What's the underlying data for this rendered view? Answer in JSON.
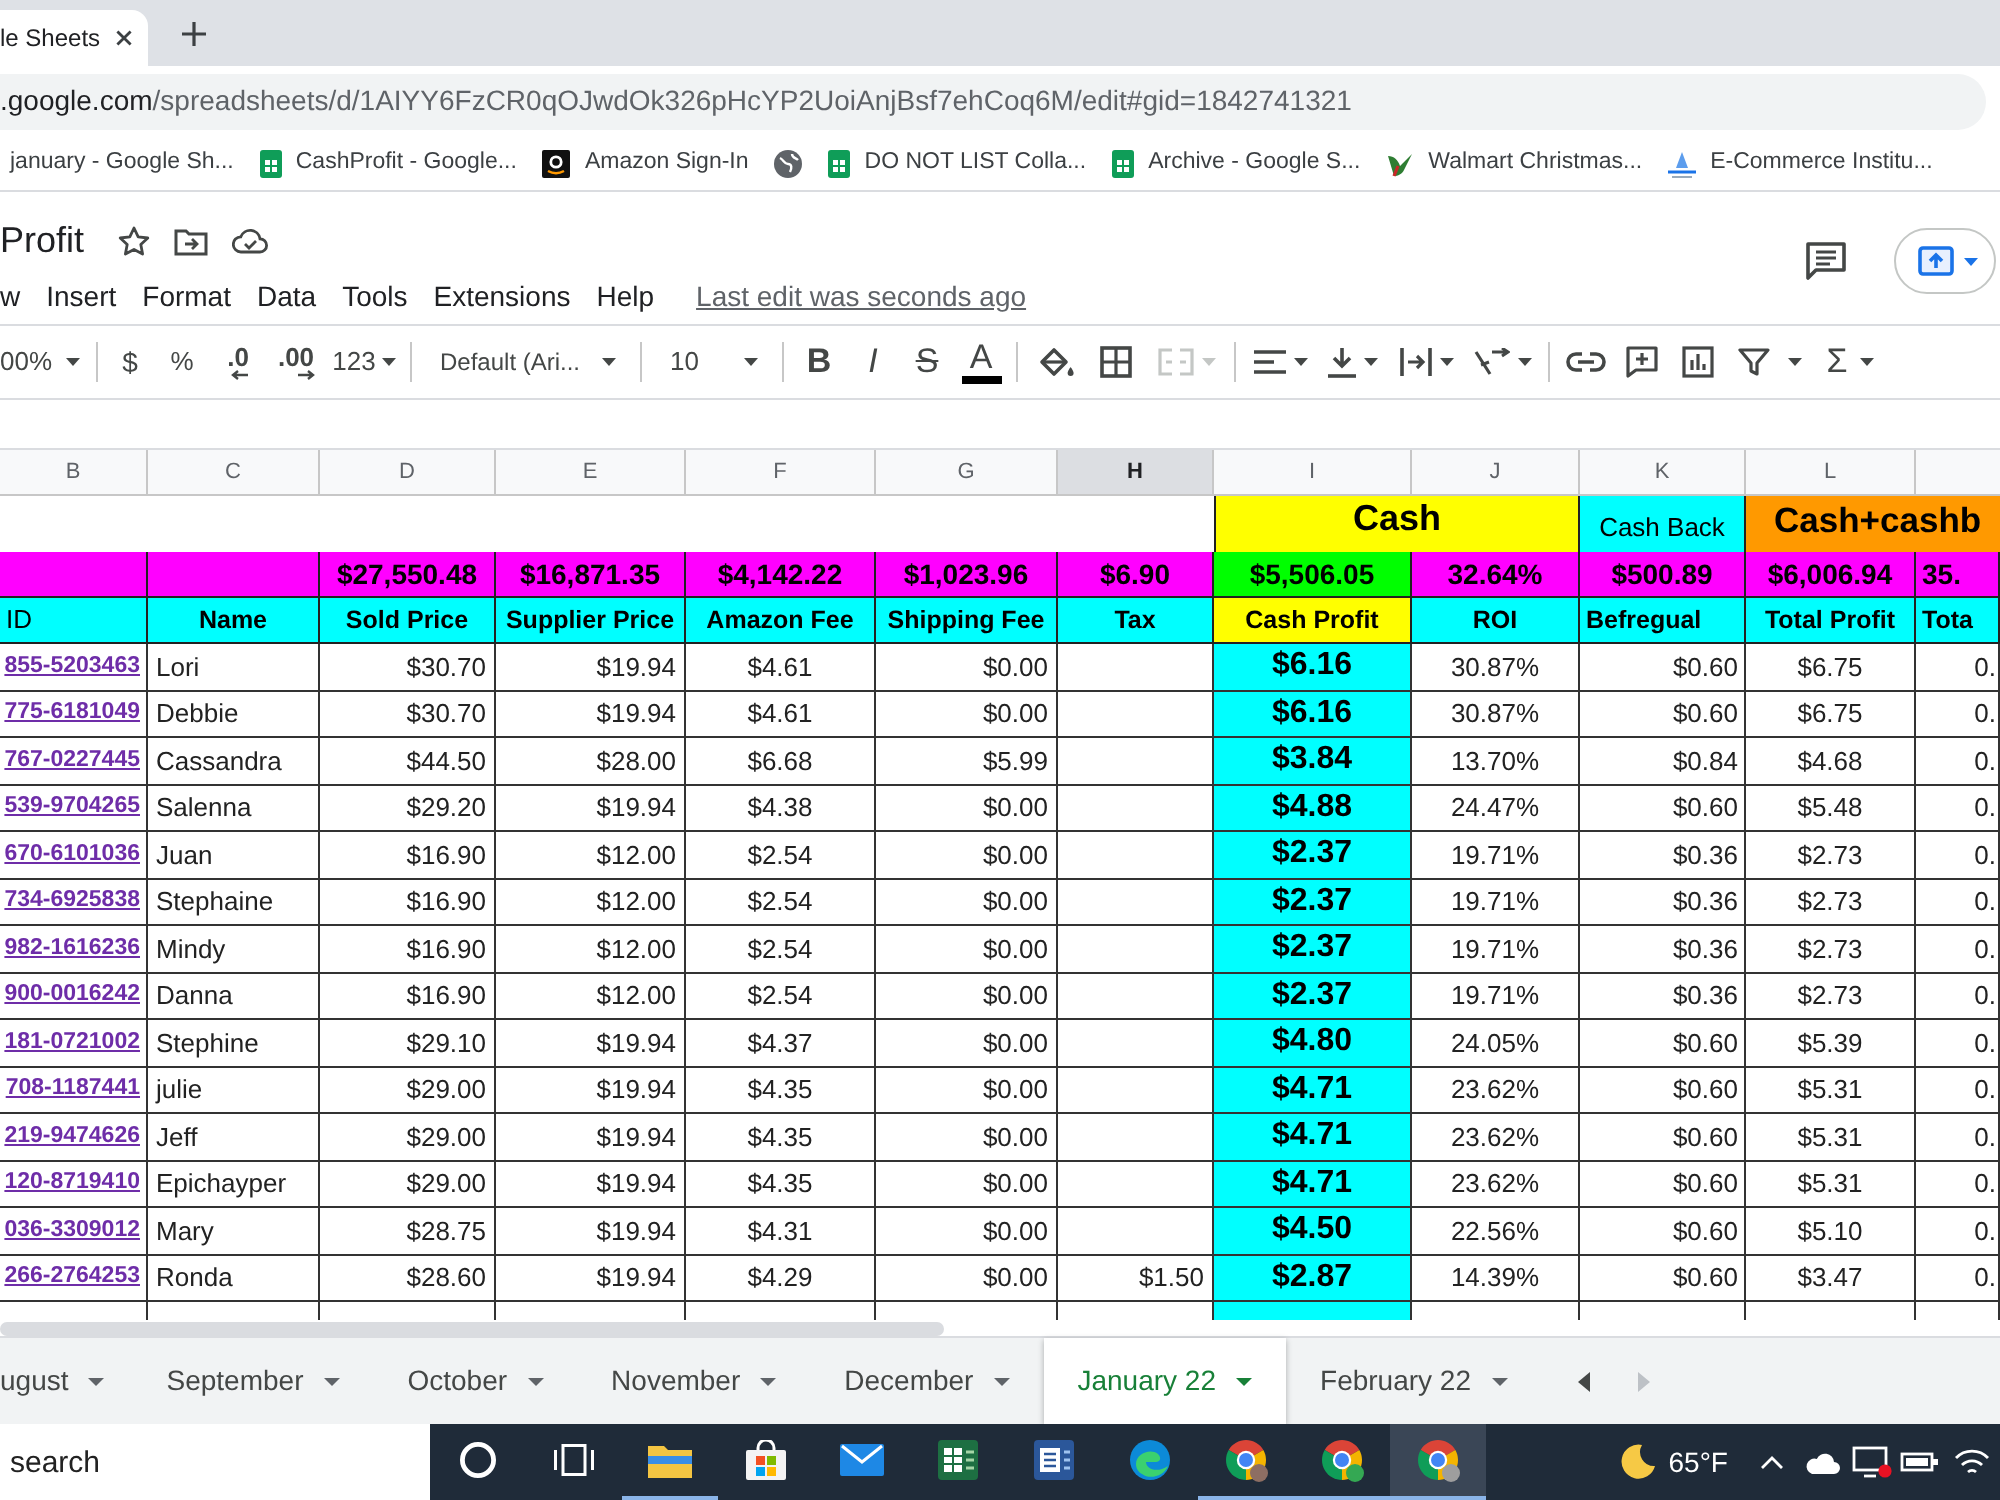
{
  "browser": {
    "tab_title": "le Sheets",
    "url": {
      "host": ".google.com",
      "path": "/spreadsheets/d/1AIYY6FzCR0qOJwdOk326pHcYP2UoiAnjBsf7ehCoq6M/edit#gid=1842741321"
    },
    "bookmarks": [
      {
        "kind": "plain",
        "label": "january - Google Sh..."
      },
      {
        "kind": "sheet",
        "label": "CashProfit - Google..."
      },
      {
        "kind": "shop",
        "label": "Amazon Sign-In"
      },
      {
        "kind": "globe"
      },
      {
        "kind": "sheet",
        "label": "DO NOT LIST Colla..."
      },
      {
        "kind": "sheet",
        "label": "Archive - Google S..."
      },
      {
        "kind": "bird",
        "label": "Walmart Christmas..."
      },
      {
        "kind": "site",
        "label": "E-Commerce Institu..."
      }
    ]
  },
  "document": {
    "title": "Profit",
    "menu": [
      "w",
      "Insert",
      "Format",
      "Data",
      "Tools",
      "Extensions",
      "Help"
    ],
    "last_edit": "Last edit was seconds ago"
  },
  "toolbar": {
    "zoom": "00%",
    "currency": "$",
    "percent": "%",
    "decrease_decimals": ".0",
    "increase_decimals": ".00",
    "more_formats": "123",
    "font": "Default (Ari...",
    "font_size": "10",
    "bold": "B",
    "italic": "I",
    "strikethrough": "S",
    "text_color": "A",
    "functions": "Σ"
  },
  "sheet": {
    "column_letters": [
      {
        "letter": "B",
        "selected": false
      },
      {
        "letter": "C",
        "selected": false
      },
      {
        "letter": "D",
        "selected": false
      },
      {
        "letter": "E",
        "selected": false
      },
      {
        "letter": "F",
        "selected": false
      },
      {
        "letter": "G",
        "selected": false
      },
      {
        "letter": "H",
        "selected": true
      },
      {
        "letter": "I",
        "selected": false
      },
      {
        "letter": "J",
        "selected": false
      },
      {
        "letter": "K",
        "selected": false
      },
      {
        "letter": "L",
        "selected": false
      }
    ],
    "groups": {
      "cash": "Cash",
      "cash_back": "Cash Back",
      "cash_plus_cashback": "Cash+cashb"
    },
    "totals": {
      "sold_price": "$27,550.48",
      "supplier_price": "$16,871.35",
      "amazon_fee": "$4,142.22",
      "shipping_fee": "$1,023.96",
      "tax": "$6.90",
      "cash_profit": "$5,506.05",
      "roi": "32.64%",
      "befregual": "$500.89",
      "total_profit": "$6,006.94",
      "column_12": "35."
    },
    "headers": {
      "id": "ID",
      "name": "Name",
      "sold_price": "Sold Price",
      "supplier_price": "Supplier Price",
      "amazon_fee": "Amazon Fee",
      "shipping_fee": "Shipping Fee",
      "tax": "Tax",
      "cash_profit": "Cash Profit",
      "roi": "ROI",
      "befregual": "Befregual",
      "total_profit": "Total Profit",
      "column_12": "Tota"
    },
    "rows": [
      {
        "id": "855-5203463",
        "name": "Lori",
        "sold_price": "$30.70",
        "supplier_price": "$19.94",
        "amazon_fee": "$4.61",
        "shipping_fee": "$0.00",
        "cash_profit": "$6.16",
        "roi": "30.87%",
        "befregual": "$0.60",
        "total_profit": "$6.75",
        "column_12": "0."
      },
      {
        "id": "775-6181049",
        "name": "Debbie",
        "sold_price": "$30.70",
        "supplier_price": "$19.94",
        "amazon_fee": "$4.61",
        "shipping_fee": "$0.00",
        "cash_profit": "$6.16",
        "roi": "30.87%",
        "befregual": "$0.60",
        "total_profit": "$6.75",
        "column_12": "0."
      },
      {
        "id": "767-0227445",
        "name": "Cassandra",
        "sold_price": "$44.50",
        "supplier_price": "$28.00",
        "amazon_fee": "$6.68",
        "shipping_fee": "$5.99",
        "cash_profit": "$3.84",
        "roi": "13.70%",
        "befregual": "$0.84",
        "total_profit": "$4.68",
        "column_12": "0."
      },
      {
        "id": "539-9704265",
        "name": "Salenna",
        "sold_price": "$29.20",
        "supplier_price": "$19.94",
        "amazon_fee": "$4.38",
        "shipping_fee": "$0.00",
        "cash_profit": "$4.88",
        "roi": "24.47%",
        "befregual": "$0.60",
        "total_profit": "$5.48",
        "column_12": "0."
      },
      {
        "id": "670-6101036",
        "name": "Juan",
        "sold_price": "$16.90",
        "supplier_price": "$12.00",
        "amazon_fee": "$2.54",
        "shipping_fee": "$0.00",
        "cash_profit": "$2.37",
        "roi": "19.71%",
        "befregual": "$0.36",
        "total_profit": "$2.73",
        "column_12": "0."
      },
      {
        "id": "734-6925838",
        "name": "Stephaine",
        "sold_price": "$16.90",
        "supplier_price": "$12.00",
        "amazon_fee": "$2.54",
        "shipping_fee": "$0.00",
        "cash_profit": "$2.37",
        "roi": "19.71%",
        "befregual": "$0.36",
        "total_profit": "$2.73",
        "column_12": "0."
      },
      {
        "id": "982-1616236",
        "name": "Mindy",
        "sold_price": "$16.90",
        "supplier_price": "$12.00",
        "amazon_fee": "$2.54",
        "shipping_fee": "$0.00",
        "cash_profit": "$2.37",
        "roi": "19.71%",
        "befregual": "$0.36",
        "total_profit": "$2.73",
        "column_12": "0."
      },
      {
        "id": "900-0016242",
        "name": "Danna",
        "sold_price": "$16.90",
        "supplier_price": "$12.00",
        "amazon_fee": "$2.54",
        "shipping_fee": "$0.00",
        "cash_profit": "$2.37",
        "roi": "19.71%",
        "befregual": "$0.36",
        "total_profit": "$2.73",
        "column_12": "0."
      },
      {
        "id": "181-0721002",
        "name": "Stephine",
        "sold_price": "$29.10",
        "supplier_price": "$19.94",
        "amazon_fee": "$4.37",
        "shipping_fee": "$0.00",
        "cash_profit": "$4.80",
        "roi": "24.05%",
        "befregual": "$0.60",
        "total_profit": "$5.39",
        "column_12": "0."
      },
      {
        "id": "708-1187441",
        "name": "julie",
        "sold_price": "$29.00",
        "supplier_price": "$19.94",
        "amazon_fee": "$4.35",
        "shipping_fee": "$0.00",
        "cash_profit": "$4.71",
        "roi": "23.62%",
        "befregual": "$0.60",
        "total_profit": "$5.31",
        "column_12": "0."
      },
      {
        "id": "219-9474626",
        "name": "Jeff",
        "sold_price": "$29.00",
        "supplier_price": "$19.94",
        "amazon_fee": "$4.35",
        "shipping_fee": "$0.00",
        "cash_profit": "$4.71",
        "roi": "23.62%",
        "befregual": "$0.60",
        "total_profit": "$5.31",
        "column_12": "0."
      },
      {
        "id": "120-8719410",
        "name": "Epichayper",
        "sold_price": "$29.00",
        "supplier_price": "$19.94",
        "amazon_fee": "$4.35",
        "shipping_fee": "$0.00",
        "cash_profit": "$4.71",
        "roi": "23.62%",
        "befregual": "$0.60",
        "total_profit": "$5.31",
        "column_12": "0."
      },
      {
        "id": "036-3309012",
        "name": "Mary",
        "sold_price": "$28.75",
        "supplier_price": "$19.94",
        "amazon_fee": "$4.31",
        "shipping_fee": "$0.00",
        "cash_profit": "$4.50",
        "roi": "22.56%",
        "befregual": "$0.60",
        "total_profit": "$5.10",
        "column_12": "0."
      },
      {
        "id": "266-2764253",
        "name": "Ronda",
        "sold_price": "$28.60",
        "supplier_price": "$19.94",
        "amazon_fee": "$4.29",
        "shipping_fee": "$0.00",
        "tax": "$1.50",
        "cash_profit": "$2.87",
        "roi": "14.39%",
        "befregual": "$0.60",
        "total_profit": "$3.47",
        "column_12": "0."
      }
    ]
  },
  "sheet_tabs": [
    {
      "label": "ugust",
      "selected": false
    },
    {
      "label": "September",
      "selected": false
    },
    {
      "label": "October",
      "selected": false
    },
    {
      "label": "November",
      "selected": false
    },
    {
      "label": "December",
      "selected": false
    },
    {
      "label": "January 22",
      "selected": true
    },
    {
      "label": "February 22",
      "selected": false
    }
  ],
  "taskbar": {
    "search": {
      "placeholder": "search"
    },
    "apps": [
      {
        "running": false,
        "selected": false
      },
      {
        "running": false,
        "selected": false
      },
      {
        "running": true,
        "selected": false
      },
      {
        "running": false,
        "selected": false
      },
      {
        "running": false,
        "selected": false
      },
      {
        "running": false,
        "selected": false
      },
      {
        "running": false,
        "selected": false
      },
      {
        "running": false,
        "selected": false
      },
      {
        "running": true,
        "selected": false
      },
      {
        "running": true,
        "selected": false
      },
      {
        "running": true,
        "selected": true
      }
    ],
    "temperature": "65°F"
  }
}
